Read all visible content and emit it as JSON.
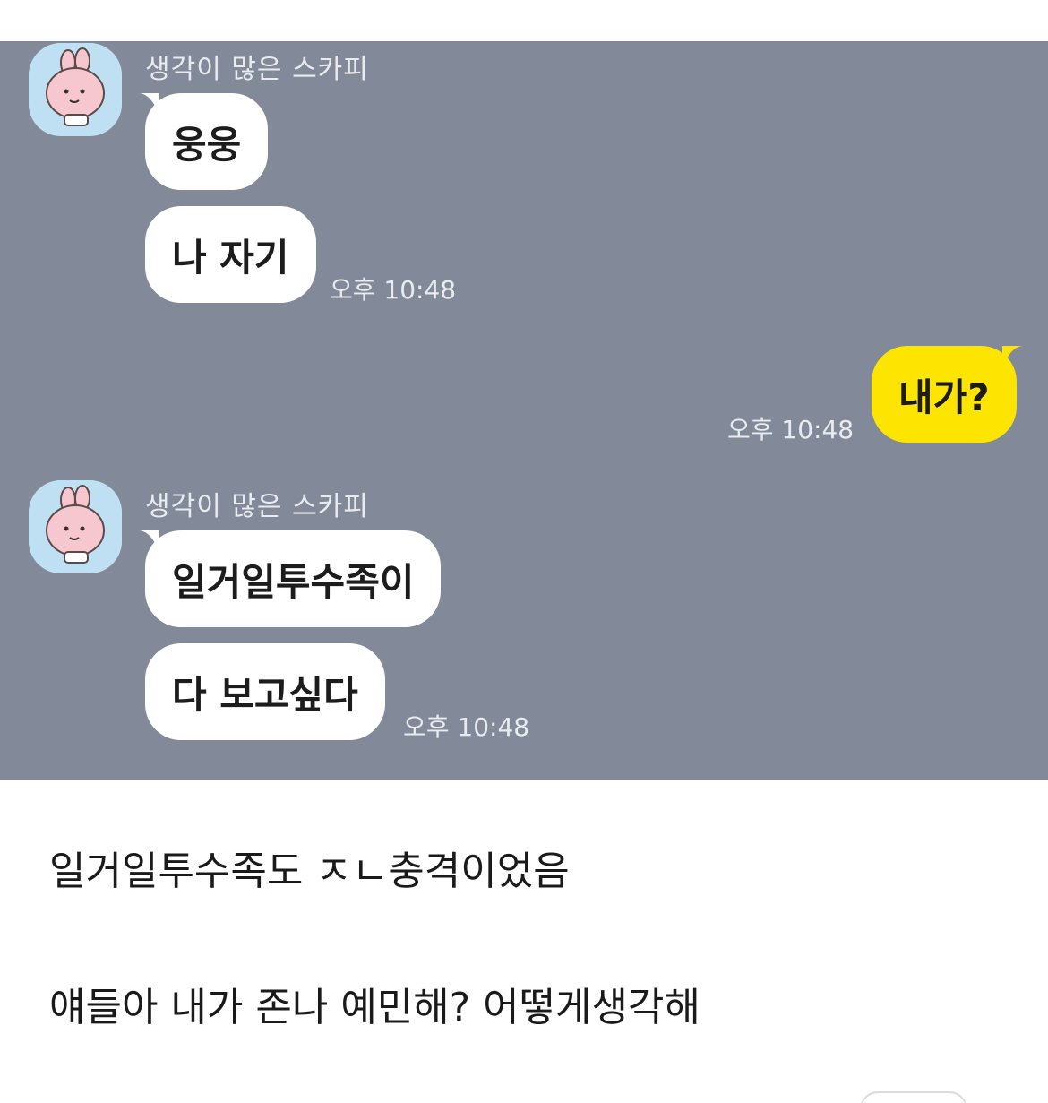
{
  "chat": {
    "group1": {
      "sender": "생각이 많은 스카피",
      "messages": [
        "웅웅",
        "나 자기"
      ],
      "time": "오후 10:48"
    },
    "mine": {
      "message": "내가?",
      "time": "오후 10:48"
    },
    "group2": {
      "sender": "생각이 많은 스카피",
      "messages": [
        "일거일투수족이",
        "다 보고싶다"
      ],
      "time": "오후 10:48"
    }
  },
  "post": {
    "lines": [
      "일거일투수족도 ㅈㄴ충격이었음",
      "얘들아 내가 존나 예민해? 어떻게생각해"
    ]
  },
  "colors": {
    "chat_background": "#828a99",
    "incoming_bubble": "#ffffff",
    "outgoing_bubble": "#fee501",
    "avatar_background": "#bfe0f2"
  },
  "icons": {
    "avatar": "pink-bunny-character-icon"
  }
}
